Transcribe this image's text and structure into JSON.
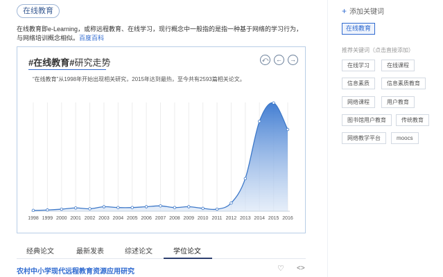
{
  "keyword_pill": "在线教育",
  "intro": {
    "text": "在线教育即e-Learning，或称远程教育、在线学习，现行概念中一般指的是指一种基于网络的学习行为，与网络培训概念相似。",
    "link": "百度百科"
  },
  "chart_card": {
    "title_hash": "#在线教育#",
    "title_suffix": "研究走势",
    "subtitle": "“在线教育”从1998年开始出现相关研究，2015年达到最热，至今共有2593篇相关论文。",
    "nav": [
      "⤺",
      "←",
      "→"
    ]
  },
  "chart_data": {
    "type": "area",
    "x": [
      "1998",
      "1999",
      "2000",
      "2001",
      "2002",
      "2003",
      "2004",
      "2005",
      "2006",
      "2007",
      "2008",
      "2009",
      "2010",
      "2011",
      "2012",
      "2013",
      "2014",
      "2015",
      "2016"
    ],
    "values": [
      2,
      3,
      5,
      8,
      6,
      11,
      9,
      9,
      11,
      13,
      9,
      11,
      7,
      5,
      20,
      80,
      220,
      265,
      200
    ],
    "ylim": [
      0,
      300
    ],
    "grid": "vertical",
    "colors": {
      "line": "#3d78c8",
      "fill_top": "#3a78d0",
      "fill_bottom": "#dbe7f7",
      "point": "#ffffff"
    }
  },
  "tabs": {
    "items": [
      "经典论文",
      "最新发表",
      "综述论文",
      "学位论文"
    ],
    "active": 3
  },
  "result": {
    "title": "农村中小学现代远程教育资源应用研究",
    "heart_icon": "heart-icon",
    "code_icon": "code-icon"
  },
  "sidebar": {
    "add_label": "添加关键词",
    "current_tag": "在线教育",
    "rec_label": "推荐关键词（点击直接添加）",
    "tags": [
      "在线学习",
      "在线课程",
      "信息素质",
      "信息素质教育",
      "网络课程",
      "用户教育",
      "图书馆用户教育",
      "传统教育",
      "网络教学平台",
      "moocs"
    ]
  }
}
